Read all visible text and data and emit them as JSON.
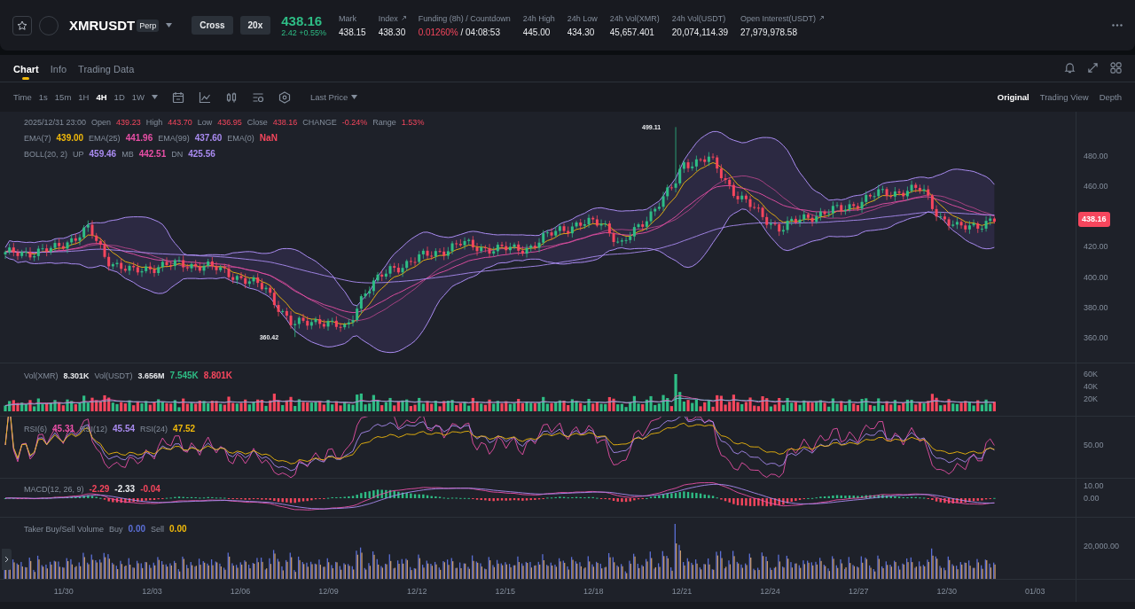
{
  "header": {
    "symbol": "XMRUSDT",
    "contract": "Perp",
    "margin_mode": "Cross",
    "leverage": "20x",
    "last_price": "438.16",
    "change": "2.42 +0.55%",
    "stats": [
      {
        "kind": "plain",
        "label": "Mark",
        "value": "438.15"
      },
      {
        "kind": "link",
        "label": "Index",
        "value": "438.30"
      },
      {
        "kind": "funding",
        "label": "Funding (8h) / Countdown",
        "rate": "0.01260%",
        "value": "/ 04:08:53"
      },
      {
        "kind": "plain",
        "label": "24h High",
        "value": "445.00"
      },
      {
        "kind": "plain",
        "label": "24h Low",
        "value": "434.30"
      },
      {
        "kind": "plain",
        "label": "24h Vol(XMR)",
        "value": "45,657.401"
      },
      {
        "kind": "plain",
        "label": "24h Vol(USDT)",
        "value": "20,074,114.39"
      },
      {
        "kind": "link",
        "label": "Open Interest(USDT)",
        "value": "27,979,978.58"
      }
    ]
  },
  "tabs": [
    {
      "label": "Chart",
      "selected": true
    },
    {
      "label": "Info",
      "selected": false
    },
    {
      "label": "Trading Data",
      "selected": false
    }
  ],
  "intervals": [
    {
      "label": "Time",
      "selected": false
    },
    {
      "label": "1s",
      "selected": false
    },
    {
      "label": "15m",
      "selected": false
    },
    {
      "label": "1H",
      "selected": false
    },
    {
      "label": "4H",
      "selected": true
    },
    {
      "label": "1D",
      "selected": false
    },
    {
      "label": "1W",
      "selected": false
    }
  ],
  "price_type": "Last Price",
  "views": [
    {
      "label": "Original",
      "selected": true
    },
    {
      "label": "Trading View",
      "selected": false
    },
    {
      "label": "Depth",
      "selected": false
    }
  ],
  "chart": {
    "timestamp": "2025/12/31 23:00",
    "ohlc": [
      {
        "label": "Open",
        "value": "439.23"
      },
      {
        "label": "High",
        "value": "443.70"
      },
      {
        "label": "Low",
        "value": "436.95"
      },
      {
        "label": "Close",
        "value": "438.16"
      },
      {
        "label": "CHANGE",
        "value": "-0.24%"
      },
      {
        "label": "Range",
        "value": "1.53%"
      }
    ],
    "ema": [
      {
        "label": "EMA(7)",
        "value": "439.00",
        "color": "#f0b90b"
      },
      {
        "label": "EMA(25)",
        "value": "441.96",
        "color": "#e84fa6"
      },
      {
        "label": "EMA(99)",
        "value": "437.60",
        "color": "#a98bf0"
      },
      {
        "label": "EMA(0)",
        "value": "NaN",
        "color": "#f6465d"
      }
    ],
    "boll_label": "BOLL(20, 2)",
    "boll": [
      {
        "label": "UP",
        "value": "459.46",
        "color": "#a98bf0"
      },
      {
        "label": "MB",
        "value": "442.51",
        "color": "#e84fa6"
      },
      {
        "label": "DN",
        "value": "425.56",
        "color": "#a98bf0"
      }
    ],
    "high_marker": "499.11",
    "low_marker": "360.42",
    "price_axis": [
      "480.00",
      "460.00",
      "420.00",
      "400.00",
      "380.00",
      "360.00"
    ],
    "current_price": "438.16"
  },
  "volume": {
    "items": [
      {
        "label": "Vol(XMR)",
        "value": "8.301K",
        "color": "#eaecef"
      },
      {
        "label": "Vol(USDT)",
        "value": "3.656M",
        "color": "#eaecef"
      },
      {
        "value": "7.545K",
        "color": "#2ebd85"
      },
      {
        "value": "8.801K",
        "color": "#f6465d"
      }
    ],
    "axis": [
      "60K",
      "40K",
      "20K"
    ]
  },
  "rsi": {
    "items": [
      {
        "label": "RSI(6)",
        "value": "45.31",
        "color": "#e84fa6"
      },
      {
        "label": "RSI(12)",
        "value": "45.54",
        "color": "#a98bf0"
      },
      {
        "label": "RSI(24)",
        "value": "47.52",
        "color": "#f0b90b"
      }
    ],
    "axis": [
      "50.00"
    ]
  },
  "macd": {
    "label": "MACD(12, 26, 9)",
    "items": [
      {
        "value": "-2.29",
        "color": "#f6465d"
      },
      {
        "value": "-2.33",
        "color": "#eaecef"
      },
      {
        "value": "-0.04",
        "color": "#f6465d"
      }
    ],
    "axis": [
      "10.00",
      "0.00"
    ]
  },
  "taker": {
    "label": "Taker Buy/Sell Volume",
    "items": [
      {
        "label": "Buy",
        "value": "0.00",
        "color": "#5b6fd6"
      },
      {
        "label": "Sell",
        "value": "0.00",
        "color": "#f0b90b"
      }
    ],
    "axis": [
      "20,000.00"
    ]
  },
  "time_axis": [
    "11/30",
    "12/03",
    "12/06",
    "12/09",
    "12/12",
    "12/15",
    "12/18",
    "12/21",
    "12/24",
    "12/27",
    "12/30",
    "01/03"
  ]
}
